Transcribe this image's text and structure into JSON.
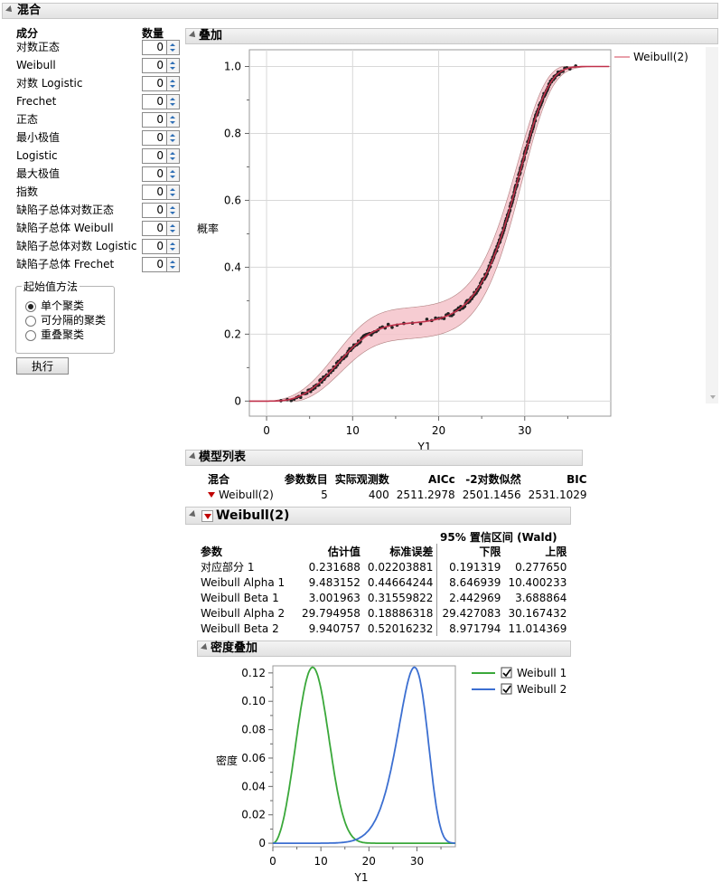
{
  "mix": {
    "title": "混合",
    "col_component": "成分",
    "col_count": "数量",
    "components": [
      {
        "label": "对数正态",
        "count": "0"
      },
      {
        "label": "Weibull",
        "count": "0"
      },
      {
        "label": "对数 Logistic",
        "count": "0"
      },
      {
        "label": "Frechet",
        "count": "0"
      },
      {
        "label": "正态",
        "count": "0"
      },
      {
        "label": "最小极值",
        "count": "0"
      },
      {
        "label": "Logistic",
        "count": "0"
      },
      {
        "label": "最大极值",
        "count": "0"
      },
      {
        "label": "指数",
        "count": "0"
      },
      {
        "label": "缺陷子总体对数正态",
        "count": "0"
      },
      {
        "label": "缺陷子总体 Weibull",
        "count": "0"
      },
      {
        "label": "缺陷子总体对数 Logistic",
        "count": "0"
      },
      {
        "label": "缺陷子总体 Frechet",
        "count": "0"
      }
    ],
    "start_method": {
      "title": "起始值方法",
      "options": [
        "单个聚类",
        "可分隔的聚类",
        "重叠聚类"
      ],
      "selected": 0
    },
    "run_label": "执行"
  },
  "overlay": {
    "title": "叠加",
    "legend": "Weibull(2)",
    "ylabel": "概率",
    "xlabel": "Y1",
    "yticks": [
      "1.0",
      "0.8",
      "0.6",
      "0.4",
      "0.2",
      "0"
    ],
    "xticks": [
      "0",
      "10",
      "20",
      "30"
    ]
  },
  "model_list": {
    "title": "模型列表",
    "headers": [
      "混合",
      "参数数目",
      "实际观测数",
      "AICc",
      "-2对数似然",
      "BIC"
    ],
    "row": [
      "Weibull(2)",
      "5",
      "400",
      "2511.2978",
      "2501.1456",
      "2531.1029"
    ]
  },
  "weibull": {
    "title": "Weibull(2)",
    "ci_header": "95% 置信区间 (Wald)",
    "headers": [
      "参数",
      "估计值",
      "标准误差",
      "下限",
      "上限"
    ],
    "rows": [
      [
        "对应部分 1",
        "0.231688",
        "0.02203881",
        "0.191319",
        "0.277650"
      ],
      [
        "Weibull Alpha 1",
        "9.483152",
        "0.44664244",
        "8.646939",
        "10.400233"
      ],
      [
        "Weibull Beta 1",
        "3.001963",
        "0.31559822",
        "2.442969",
        "3.688864"
      ],
      [
        "Weibull Alpha 2",
        "29.794958",
        "0.18886318",
        "29.427083",
        "30.167432"
      ],
      [
        "Weibull Beta 2",
        "9.940757",
        "0.52016232",
        "8.971794",
        "11.014369"
      ]
    ]
  },
  "density": {
    "title": "密度叠加",
    "ylabel": "密度",
    "xlabel": "Y1",
    "yticks": [
      "0.12",
      "0.10",
      "0.08",
      "0.06",
      "0.04",
      "0.02",
      "0"
    ],
    "xticks": [
      "0",
      "10",
      "20",
      "30"
    ],
    "legend": [
      "Weibull 1",
      "Weibull 2"
    ]
  },
  "chart_data": [
    {
      "type": "line",
      "xlabel": "Y1",
      "ylabel": "概率",
      "xlim": [
        -2,
        40
      ],
      "ylim": [
        0,
        1.0
      ],
      "series": [
        {
          "name": "Weibull(2)",
          "params": {
            "p1": 0.231688,
            "alpha1": 9.483152,
            "beta1": 3.001963,
            "alpha2": 29.794958,
            "beta2": 9.940757
          }
        }
      ],
      "colors": {
        "fit": "#c0304a",
        "band": "#f2b8c0",
        "points": "#222222"
      }
    },
    {
      "type": "line",
      "xlabel": "Y1",
      "ylabel": "密度",
      "xlim": [
        0,
        38
      ],
      "ylim": [
        0,
        0.125
      ],
      "series": [
        {
          "name": "Weibull 1",
          "color": "#3aa83a",
          "alpha": 9.483152,
          "beta": 3.001963
        },
        {
          "name": "Weibull 2",
          "color": "#3c6fd1",
          "alpha": 29.794958,
          "beta": 9.940757
        }
      ]
    }
  ]
}
